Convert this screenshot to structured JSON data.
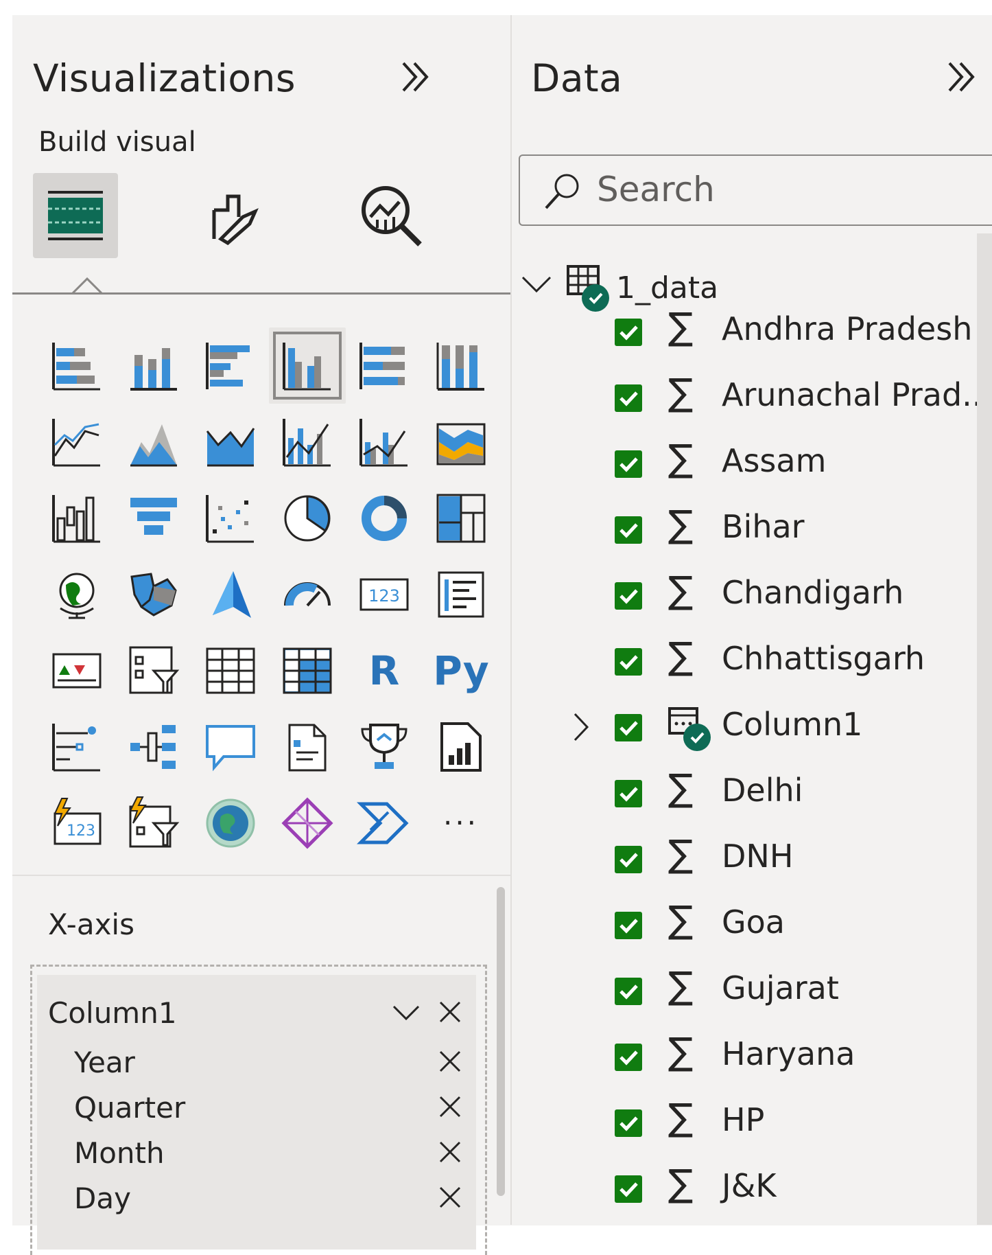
{
  "visualizations": {
    "title": "Visualizations",
    "subtitle": "Build visual",
    "tabs": [
      {
        "icon": "build-visual-icon",
        "active": true
      },
      {
        "icon": "format-visual-icon",
        "active": false
      },
      {
        "icon": "analytics-icon",
        "active": false
      }
    ],
    "gallery": [
      "stacked-bar-chart-icon",
      "stacked-column-chart-icon",
      "clustered-bar-chart-icon",
      "clustered-column-chart-icon",
      "100-stacked-bar-chart-icon",
      "100-stacked-column-chart-icon",
      "line-chart-icon",
      "area-chart-icon",
      "stacked-area-chart-icon",
      "line-and-stacked-column-icon",
      "line-and-clustered-column-icon",
      "ribbon-chart-icon",
      "waterfall-chart-icon",
      "funnel-icon",
      "scatter-chart-icon",
      "pie-chart-icon",
      "donut-chart-icon",
      "treemap-icon",
      "map-icon",
      "filled-map-icon",
      "azure-map-icon",
      "gauge-icon",
      "card-icon",
      "multi-row-card-icon",
      "kpi-icon",
      "slicer-icon",
      "table-icon",
      "matrix-icon",
      "r-script-visual-icon",
      "python-visual-icon",
      "key-influencers-icon",
      "decomposition-tree-icon",
      "qa-icon",
      "smart-narrative-icon",
      "metrics-icon",
      "paginated-report-icon",
      "card-new-icon",
      "slicer-new-icon",
      "arcgis-map-icon",
      "power-apps-icon",
      "power-automate-icon",
      "more-visuals-icon"
    ],
    "selected_index": 3,
    "r_label": "R",
    "py_label": "Py",
    "card_label": "123",
    "more_label": "···",
    "well": {
      "title": "X-axis",
      "field": "Column1",
      "hierarchy": [
        "Year",
        "Quarter",
        "Month",
        "Day"
      ]
    }
  },
  "data_pane": {
    "title": "Data",
    "search_placeholder": "Search",
    "table": "1_data",
    "fields": [
      {
        "label": "Andhra Pradesh",
        "type": "sigma"
      },
      {
        "label": "Arunachal Prad...",
        "type": "sigma"
      },
      {
        "label": "Assam",
        "type": "sigma"
      },
      {
        "label": "Bihar",
        "type": "sigma"
      },
      {
        "label": "Chandigarh",
        "type": "sigma"
      },
      {
        "label": "Chhattisgarh",
        "type": "sigma"
      },
      {
        "label": "Column1",
        "type": "date-hierarchy"
      },
      {
        "label": "Delhi",
        "type": "sigma"
      },
      {
        "label": "DNH",
        "type": "sigma"
      },
      {
        "label": "Goa",
        "type": "sigma"
      },
      {
        "label": "Gujarat",
        "type": "sigma"
      },
      {
        "label": "Haryana",
        "type": "sigma"
      },
      {
        "label": "HP",
        "type": "sigma"
      },
      {
        "label": "J&K",
        "type": "sigma"
      }
    ],
    "sigma_symbol": "∑"
  },
  "colors": {
    "accent_green": "#107c10",
    "chart_blue": "#3a8fd6",
    "chart_gray": "#8a8886"
  }
}
